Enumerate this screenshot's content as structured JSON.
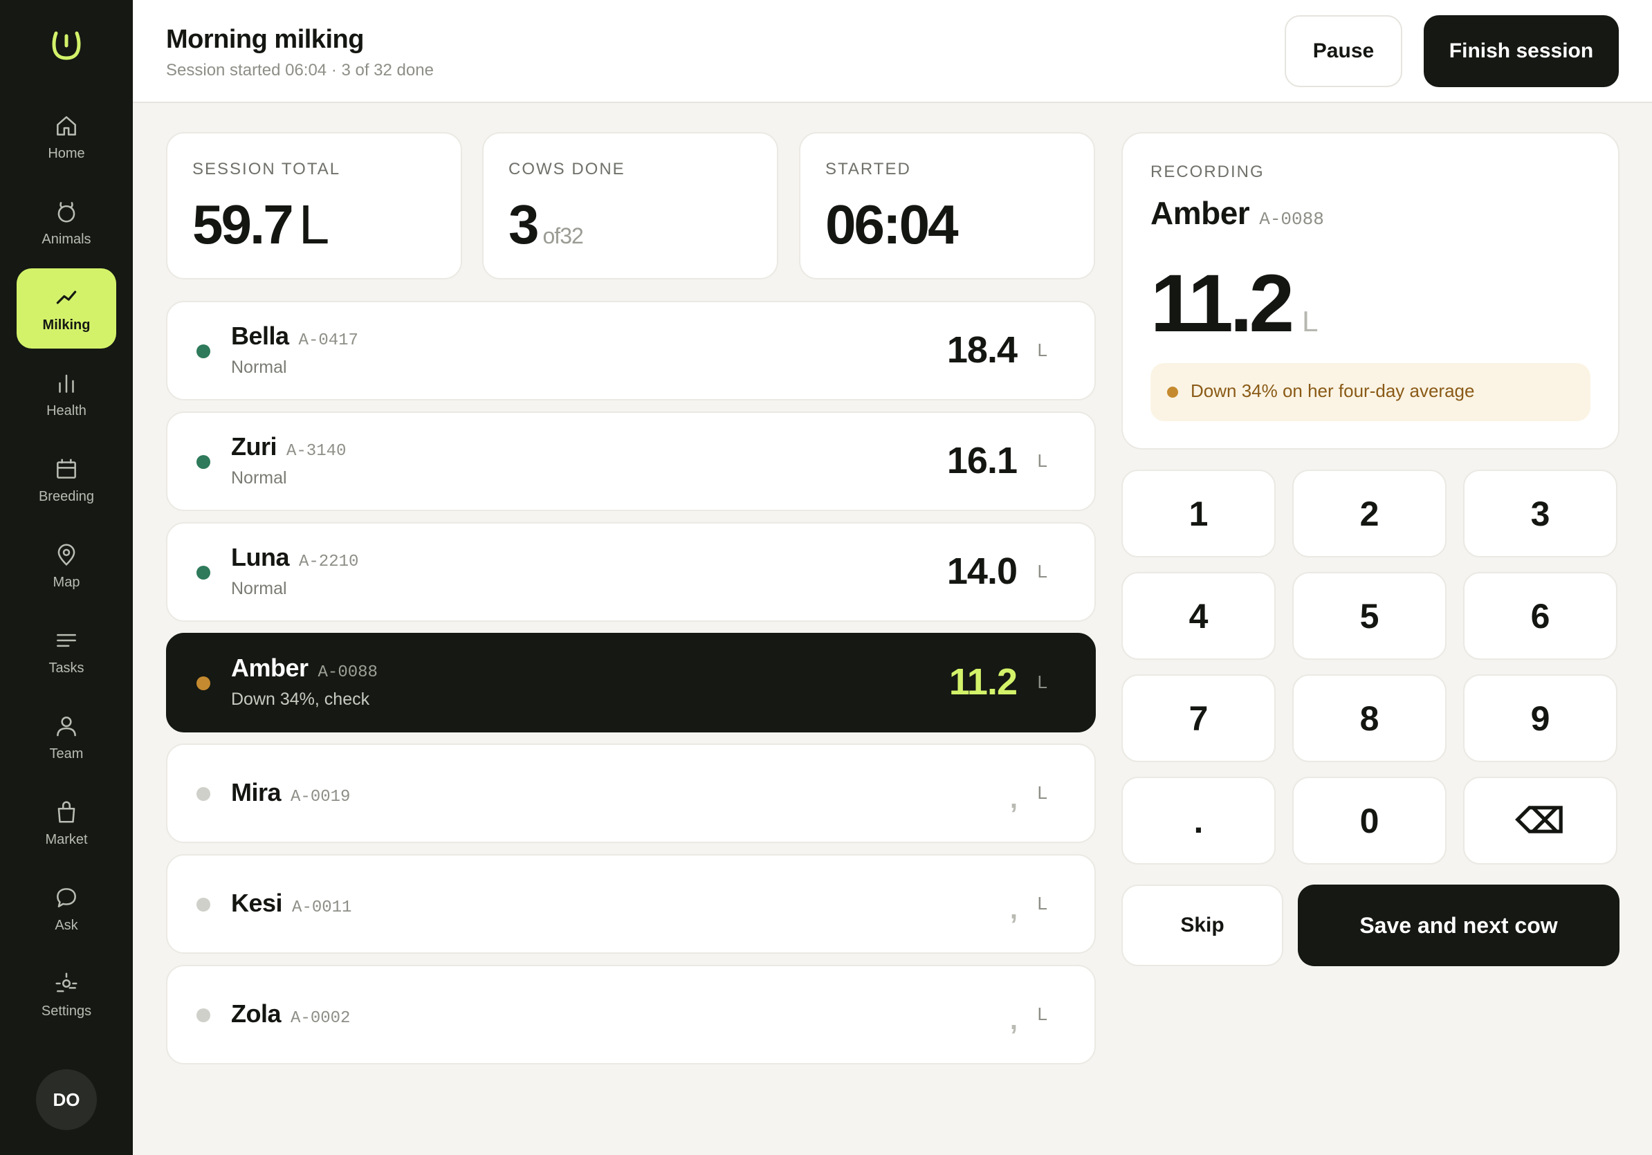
{
  "nav": {
    "items": [
      {
        "label": "Home",
        "icon": "home-icon"
      },
      {
        "label": "Animals",
        "icon": "cow-icon"
      },
      {
        "label": "Milking",
        "icon": "trend-icon"
      },
      {
        "label": "Health",
        "icon": "bars-icon"
      },
      {
        "label": "Breeding",
        "icon": "calendar-icon"
      },
      {
        "label": "Map",
        "icon": "pin-icon"
      },
      {
        "label": "Tasks",
        "icon": "list-icon"
      },
      {
        "label": "Team",
        "icon": "person-icon"
      },
      {
        "label": "Market",
        "icon": "bag-icon"
      },
      {
        "label": "Ask",
        "icon": "chat-icon"
      },
      {
        "label": "Settings",
        "icon": "sliders-icon"
      }
    ],
    "active": "Milking",
    "avatar": "DO"
  },
  "header": {
    "title": "Morning milking",
    "subtitle": "Session started 06:04 · 3 of 32 done",
    "pause_label": "Pause",
    "finish_label": "Finish session"
  },
  "stats": {
    "total": {
      "label": "SESSION TOTAL",
      "value": "59.7",
      "unit": "L"
    },
    "cows_done": {
      "label": "COWS DONE",
      "value": "3",
      "of": "of32"
    },
    "started": {
      "label": "STARTED",
      "value": "06:04"
    }
  },
  "cows": [
    {
      "name": "Bella",
      "tag": "A-0417",
      "status": "Normal",
      "value": "18.4",
      "unit": "L",
      "state": "normal"
    },
    {
      "name": "Zuri",
      "tag": "A-3140",
      "status": "Normal",
      "value": "16.1",
      "unit": "L",
      "state": "normal"
    },
    {
      "name": "Luna",
      "tag": "A-2210",
      "status": "Normal",
      "value": "14.0",
      "unit": "L",
      "state": "normal"
    },
    {
      "name": "Amber",
      "tag": "A-0088",
      "status": "Down 34%, check",
      "value": "11.2",
      "unit": "L",
      "state": "warning"
    },
    {
      "name": "Mira",
      "tag": "A-0019",
      "status": "",
      "value": ",",
      "unit": "L",
      "state": "pending"
    },
    {
      "name": "Kesi",
      "tag": "A-0011",
      "status": "",
      "value": ",",
      "unit": "L",
      "state": "pending"
    },
    {
      "name": "Zola",
      "tag": "A-0002",
      "status": "",
      "value": ",",
      "unit": "L",
      "state": "pending"
    }
  ],
  "recording": {
    "label": "RECORDING",
    "name": "Amber",
    "tag": "A-0088",
    "value": "11.2",
    "unit": "L",
    "alert": "Down 34% on her four-day average"
  },
  "keypad": {
    "keys": [
      "1",
      "2",
      "3",
      "4",
      "5",
      "6",
      "7",
      "8",
      "9",
      ".",
      "0",
      "⌫"
    ],
    "skip_label": "Skip",
    "save_label": "Save and next cow"
  },
  "colors": {
    "accent": "#d3f26a",
    "dark": "#151813",
    "normal": "#2e7a5a",
    "warning": "#c58a2f",
    "pending": "#cfd0ca"
  }
}
